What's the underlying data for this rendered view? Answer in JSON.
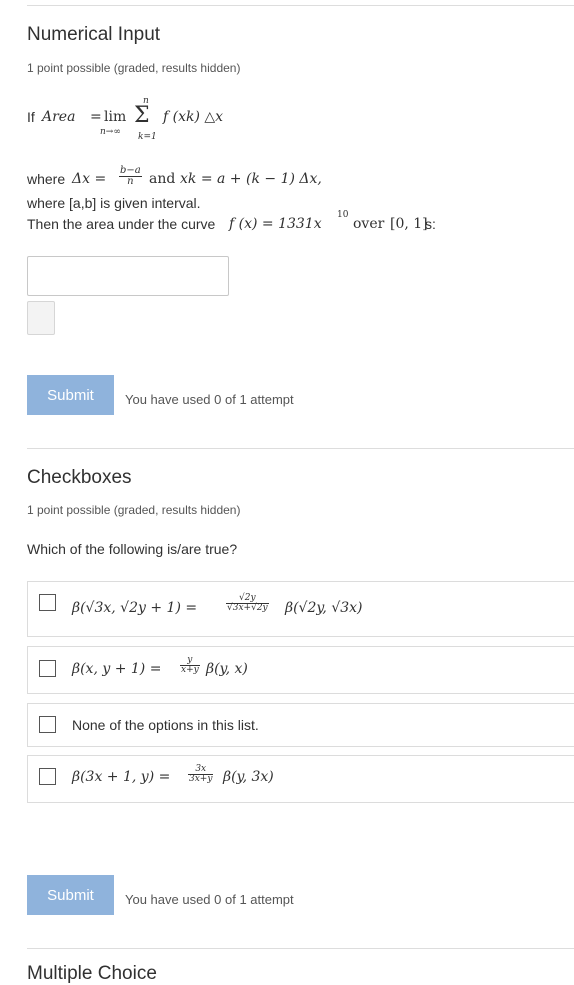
{
  "problem1": {
    "title": "Numerical Input",
    "points": "1 point possible (graded, results hidden)",
    "formula_if": "If",
    "formula_area": "Area",
    "formula_eq": "=",
    "formula_lim": "lim",
    "formula_limsub": "n→∞",
    "formula_sum_top": "n",
    "formula_sum": "Σ",
    "formula_sum_bottom": "k=1",
    "formula_body": "f (xk) △x",
    "where1_prefix": "where",
    "where1_dx": "Δx =",
    "where1_frac_num": "b−a",
    "where1_frac_den": "n",
    "where1_and": "and",
    "where1_xk": "xk = a + (k − 1) Δx,",
    "where2": "where [a,b] is given interval.",
    "then_prefix": "Then the area under the curve",
    "then_fx": "f (x) = 1331x",
    "then_exp": "10",
    "then_over": "over",
    "then_interval": "[0, 1]",
    "then_suffix": "s:",
    "input_value": "",
    "submit_label": "Submit",
    "attempts": "You have used 0 of 1 attempt"
  },
  "problem2": {
    "title": "Checkboxes",
    "points": "1 point possible (graded, results hidden)",
    "question": "Which of the following is/are true?",
    "options": [
      {
        "lhs": "β(√3x, √2y + 1) =",
        "frac_num": "√2y",
        "frac_den": "√3x+√2y",
        "rhs": "β(√2y, √3x)",
        "checked": false
      },
      {
        "lhs": "β(x, y + 1) =",
        "frac_num": "y",
        "frac_den": "x+y",
        "rhs": "β(y, x)",
        "checked": false
      },
      {
        "text": "None of the options in this list.",
        "checked": false
      },
      {
        "lhs": "β(3x + 1, y) =",
        "frac_num": "3x",
        "frac_den": "3x+y",
        "rhs": "β(y, 3x)",
        "checked": false
      }
    ],
    "submit_label": "Submit",
    "attempts": "You have used 0 of 1 attempt"
  },
  "problem3": {
    "title_partial": "Multiple Choice"
  }
}
